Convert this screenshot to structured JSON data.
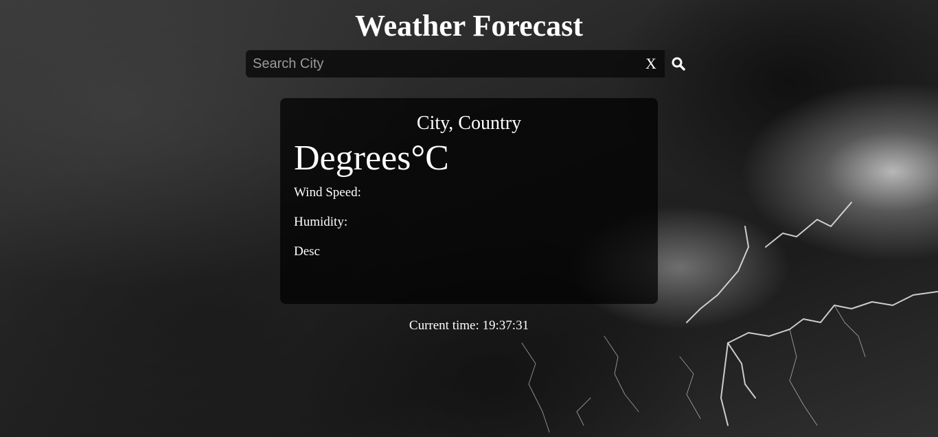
{
  "header": {
    "title": "Weather Forecast"
  },
  "search": {
    "placeholder": "Search City",
    "value": "",
    "clear_label": "X",
    "button_icon": "search-icon"
  },
  "weather": {
    "city": "City, Country",
    "temperature": "Degrees°C",
    "wind_label": "Wind Speed:",
    "humidity_label": "Humidity:",
    "description": "Desc"
  },
  "footer": {
    "time_label": "Current time:",
    "time_value": "19:37:31"
  },
  "colors": {
    "text": "#ffffff",
    "card_background": "rgba(0,0,0,0.72)",
    "search_background": "rgba(10,10,10,0.82)"
  }
}
